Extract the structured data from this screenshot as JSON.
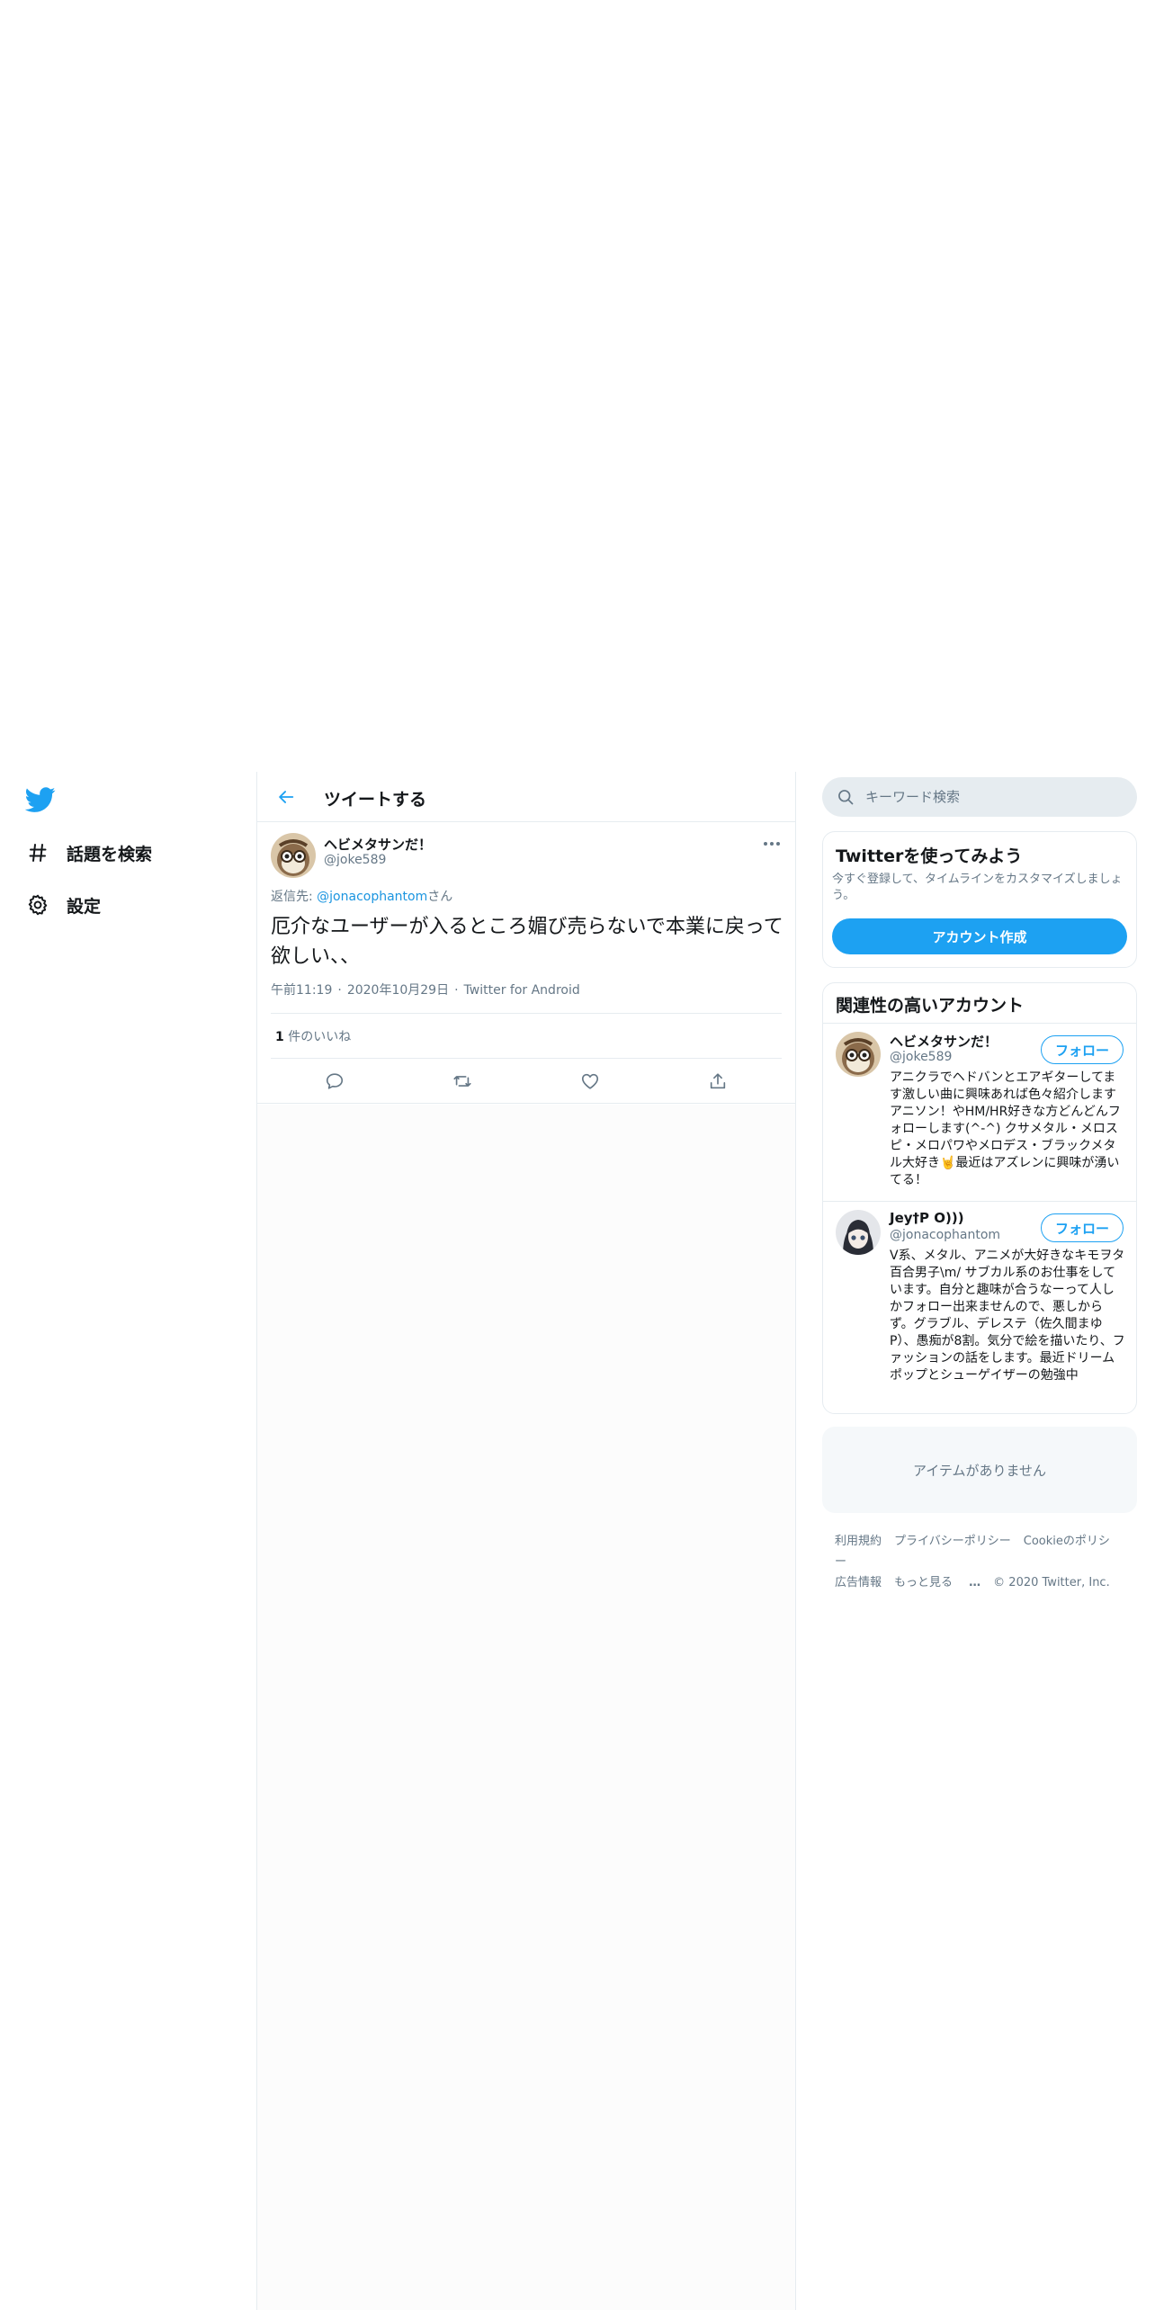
{
  "nav": {
    "logo_icon": "twitter-bird-icon",
    "explore_label": "話題を検索",
    "settings_label": "設定"
  },
  "header": {
    "title": "ツイートする"
  },
  "tweet": {
    "name": "ヘビメタサンだ！",
    "handle": "@joke589",
    "reply_prefix": "返信先: ",
    "reply_mention": "@jonacophantom",
    "reply_suffix": "さん",
    "text": "厄介なユーザーが入るところ媚び売らないで本業に戻って欲しい、、",
    "time": "午前11:19",
    "date": "2020年10月29日",
    "source": "Twitter for Android",
    "meta_dot": "·",
    "likes_count": "1",
    "likes_label": " 件のいいね"
  },
  "search": {
    "placeholder": "キーワード検索"
  },
  "signup": {
    "title": "Twitterを使ってみよう",
    "description": "今すぐ登録して、タイムラインをカスタマイズしましょう。",
    "button": "アカウント作成"
  },
  "related": {
    "title": "関連性の高いアカウント",
    "follow_label": "フォロー",
    "users": [
      {
        "name": "ヘビメタサンだ！",
        "handle": "@joke589",
        "bio": "アニクラでヘドバンとエアギターしてます激しい曲に興味あれば色々紹介します アニソン！やHM/HR好きな方どんどんフォローします(^-^) クサメタル・メロスピ・メロパワやメロデス・ブラックメタル大好き🤘最近はアズレンに興味が湧いてる！"
      },
      {
        "name": "Jey†P O)))",
        "handle": "@jonacophantom",
        "bio": "V系、メタル、アニメが大好きなキモヲタ百合男子\\m/ サブカル系のお仕事をしています。自分と趣味が合うなーって人しかフォロー出来ませんので、悪しからず。グラブル、デレステ（佐久間まゆP）、愚痴が8割。気分で絵を描いたり、ファッションの話をします。最近ドリームポップとシューゲイザーの勉強中"
      }
    ]
  },
  "trends": {
    "empty_label": "アイテムがありません"
  },
  "footer": {
    "links": [
      "利用規約",
      "プライバシーポリシー",
      "Cookieのポリシー",
      "広告情報",
      "もっと見る"
    ],
    "more_glyph": "…",
    "copyright": "© 2020 Twitter, Inc."
  },
  "colors": {
    "accent": "#1da1f2",
    "link": "#1b95e0",
    "secondary_text": "#657786",
    "border": "#e6ecf0"
  }
}
